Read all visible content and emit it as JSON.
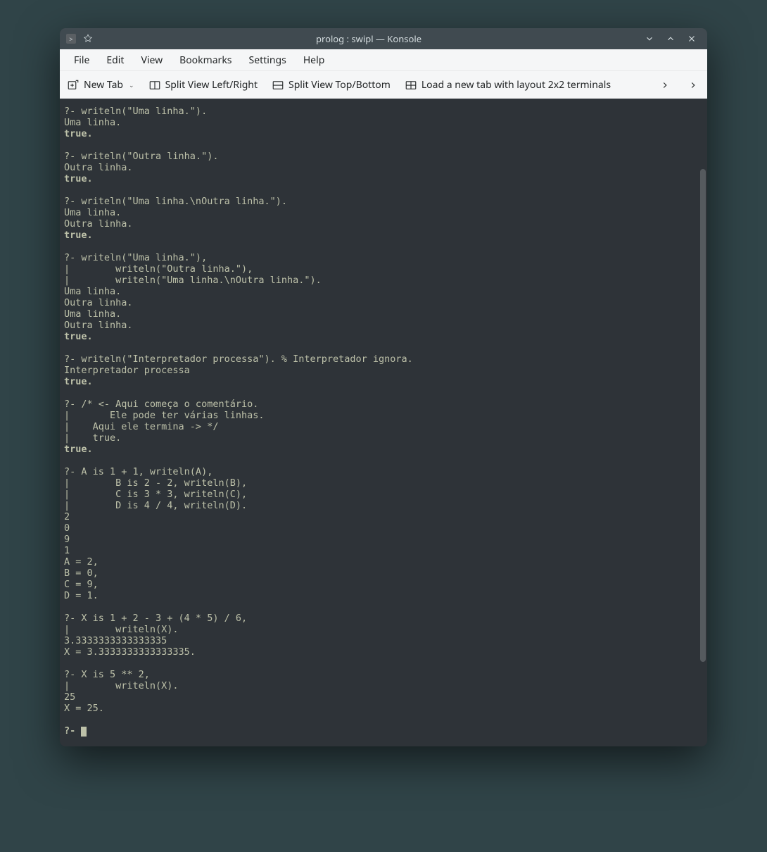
{
  "titlebar": {
    "title": "prolog : swipl — Konsole"
  },
  "menubar": {
    "file": "File",
    "edit": "Edit",
    "view": "View",
    "bookmarks": "Bookmarks",
    "settings": "Settings",
    "help": "Help"
  },
  "toolbar": {
    "new_tab": "New Tab",
    "split_lr": "Split View Left/Right",
    "split_tb": "Split View Top/Bottom",
    "load_layout": "Load a new tab with layout 2x2 terminals"
  },
  "terminal": {
    "lines": [
      {
        "t": "?- writeln(\"Uma linha.\")."
      },
      {
        "t": "Uma linha."
      },
      {
        "t": "true.",
        "b": true
      },
      {
        "t": ""
      },
      {
        "t": "?- writeln(\"Outra linha.\")."
      },
      {
        "t": "Outra linha."
      },
      {
        "t": "true.",
        "b": true
      },
      {
        "t": ""
      },
      {
        "t": "?- writeln(\"Uma linha.\\nOutra linha.\")."
      },
      {
        "t": "Uma linha."
      },
      {
        "t": "Outra linha."
      },
      {
        "t": "true.",
        "b": true
      },
      {
        "t": ""
      },
      {
        "t": "?- writeln(\"Uma linha.\"),"
      },
      {
        "t": "|        writeln(\"Outra linha.\"),"
      },
      {
        "t": "|        writeln(\"Uma linha.\\nOutra linha.\")."
      },
      {
        "t": "Uma linha."
      },
      {
        "t": "Outra linha."
      },
      {
        "t": "Uma linha."
      },
      {
        "t": "Outra linha."
      },
      {
        "t": "true.",
        "b": true
      },
      {
        "t": ""
      },
      {
        "t": "?- writeln(\"Interpretador processa\"). % Interpretador ignora."
      },
      {
        "t": "Interpretador processa"
      },
      {
        "t": "true.",
        "b": true
      },
      {
        "t": ""
      },
      {
        "t": "?- /* <- Aqui começa o comentário."
      },
      {
        "t": "|       Ele pode ter várias linhas."
      },
      {
        "t": "|    Aqui ele termina -> */"
      },
      {
        "t": "|    true."
      },
      {
        "t": "true.",
        "b": true
      },
      {
        "t": ""
      },
      {
        "t": "?- A is 1 + 1, writeln(A),"
      },
      {
        "t": "|        B is 2 - 2, writeln(B),"
      },
      {
        "t": "|        C is 3 * 3, writeln(C),"
      },
      {
        "t": "|        D is 4 / 4, writeln(D)."
      },
      {
        "t": "2"
      },
      {
        "t": "0"
      },
      {
        "t": "9"
      },
      {
        "t": "1"
      },
      {
        "t": "A = 2,"
      },
      {
        "t": "B = 0,"
      },
      {
        "t": "C = 9,"
      },
      {
        "t": "D = 1."
      },
      {
        "t": ""
      },
      {
        "t": "?- X is 1 + 2 - 3 + (4 * 5) / 6,"
      },
      {
        "t": "|        writeln(X)."
      },
      {
        "t": "3.3333333333333335"
      },
      {
        "t": "X = 3.3333333333333335."
      },
      {
        "t": ""
      },
      {
        "t": "?- X is 5 ** 2,"
      },
      {
        "t": "|        writeln(X)."
      },
      {
        "t": "25"
      },
      {
        "t": "X = 25."
      },
      {
        "t": ""
      }
    ],
    "prompt": "?- "
  }
}
